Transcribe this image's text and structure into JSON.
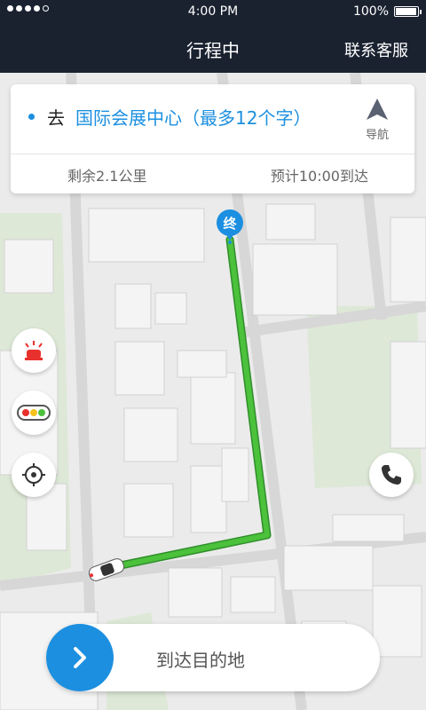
{
  "status_bar": {
    "time": "4:00 PM",
    "battery": "100%"
  },
  "header": {
    "title": "行程中",
    "service_link": "联系客服"
  },
  "trip_card": {
    "prefix": "去",
    "destination": "国际会展中心（最多12个字）",
    "nav_label": "导航",
    "remaining": "剩余2.1公里",
    "eta": "预计10:00到达"
  },
  "map": {
    "end_marker": "终",
    "route_color": "#4cc13c"
  },
  "actions": {
    "arrive_label": "到达目的地"
  },
  "icons": {
    "alarm": "alarm-light-icon",
    "traffic": "traffic-light-icon",
    "locate": "locate-icon",
    "phone": "phone-icon"
  },
  "colors": {
    "accent": "#1c8fe0",
    "header_bg": "#1a2230"
  }
}
